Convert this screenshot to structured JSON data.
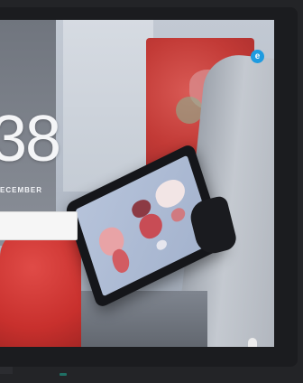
{
  "lock_screen": {
    "clock": "38",
    "date": "ECEMBER"
  },
  "icons": {
    "ease_of_access": "ease-of-access-icon",
    "power": "power-icon"
  },
  "colors": {
    "accent": "#1e9be0",
    "red_chair": "#c8302d",
    "bezel": "#1b1c1f"
  }
}
